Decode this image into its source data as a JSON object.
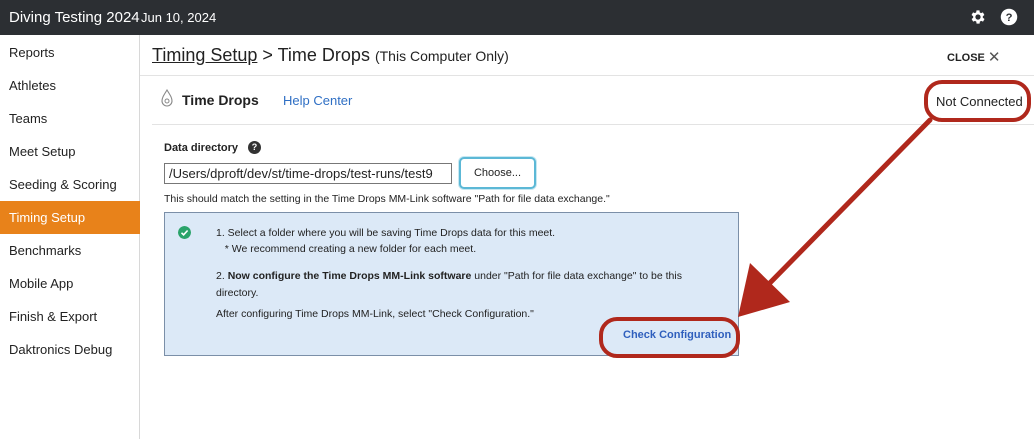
{
  "header": {
    "app_title": "Diving Testing 2024",
    "date": "Jun 10, 2024",
    "icons": [
      "gear-icon",
      "help-icon"
    ]
  },
  "sidebar": {
    "items": [
      {
        "label": "Reports"
      },
      {
        "label": "Athletes"
      },
      {
        "label": "Teams"
      },
      {
        "label": "Meet Setup"
      },
      {
        "label": "Seeding & Scoring"
      },
      {
        "label": "Timing Setup",
        "active": true
      },
      {
        "label": "Benchmarks"
      },
      {
        "label": "Mobile App"
      },
      {
        "label": "Finish & Export"
      },
      {
        "label": "Daktronics Debug"
      }
    ],
    "active_color": "#e8821a"
  },
  "page": {
    "breadcrumb_link": "Timing Setup",
    "breadcrumb_sep": " > ",
    "breadcrumb_current": "Time Drops",
    "breadcrumb_note": "(This Computer Only)",
    "close_label": "CLOSE"
  },
  "device": {
    "title": "Time Drops",
    "help_link": "Help Center",
    "status": "Not Connected"
  },
  "data_directory": {
    "label": "Data directory",
    "value": "/Users/dproft/dev/st/time-drops/test-runs/test9",
    "choose_label": "Choose...",
    "note_prefix": "This should match the setting in the Time Drops MM-Link software ",
    "note_quote": "\"Path for file data exchange.\""
  },
  "instructions": {
    "step1": "1. Select a folder where you will be saving Time Drops data for this meet.",
    "step1_sub": "* We recommend creating a new folder for each meet.",
    "step2_prefix": "2. ",
    "step2_bold": "Now configure the Time Drops MM-Link software",
    "step2_rest": " under \"Path for file data exchange\" to be this",
    "step2_line2": "directory.",
    "after": "After configuring Time Drops MM-Link, select \"Check Configuration.\"",
    "check_button": "Check Configuration"
  },
  "colors": {
    "topbar": "#2c2f33",
    "accent_orange": "#e8821a",
    "info_bg": "#dce9f7",
    "link_blue": "#2f6fc4",
    "annotation_red": "#b0281c",
    "success_green": "#2aa36a"
  }
}
